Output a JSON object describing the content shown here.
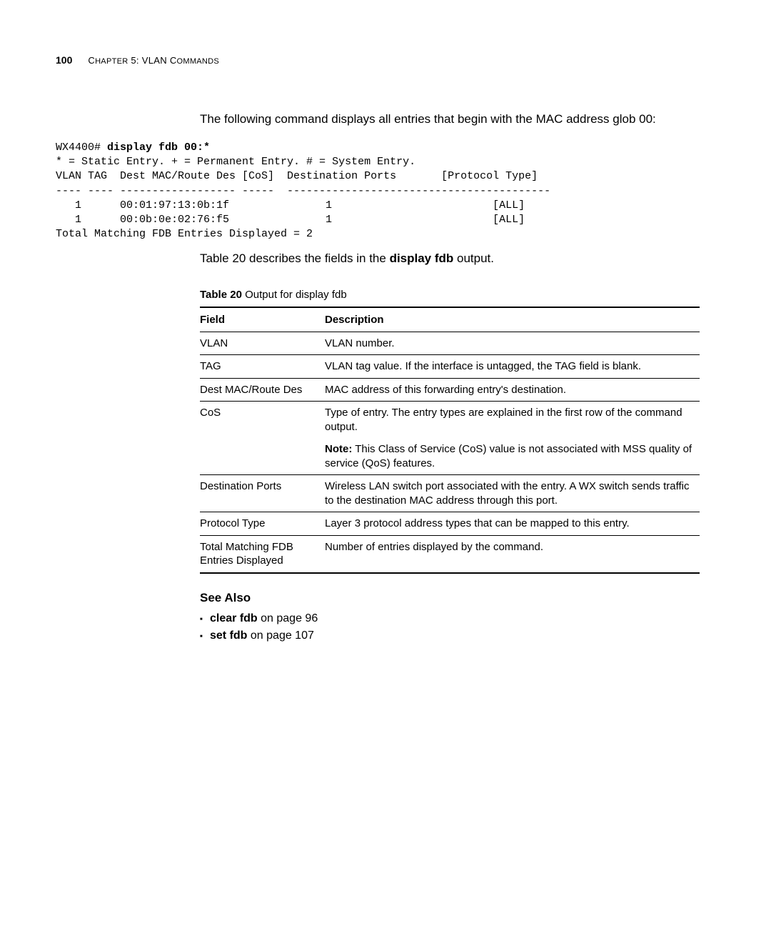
{
  "header": {
    "page_number": "100",
    "chapter_prefix": "C",
    "chapter_small1": "HAPTER",
    "chapter_mid": " 5: VLAN C",
    "chapter_small2": "OMMANDS"
  },
  "intro": "The following command displays all entries that begin with the MAC address glob 00:",
  "code": {
    "prompt": "WX4400# ",
    "cmd": "display fdb 00:*",
    "lines": "* = Static Entry. + = Permanent Entry. # = System Entry.\nVLAN TAG  Dest MAC/Route Des [CoS]  Destination Ports       [Protocol Type]\n---- ---- ------------------ -----  -----------------------------------------\n   1      00:01:97:13:0b:1f               1                         [ALL]\n   1      00:0b:0e:02:76:f5               1                         [ALL]\nTotal Matching FDB Entries Displayed = 2"
  },
  "post_code": {
    "pre": "Table 20 describes the fields in the ",
    "bold": "display fdb",
    "post": " output."
  },
  "table": {
    "caption_bold": "Table 20",
    "caption_rest": "   Output for display fdb",
    "head_field": "Field",
    "head_desc": "Description",
    "rows": [
      {
        "field": "VLAN",
        "desc": "VLAN number."
      },
      {
        "field": "TAG",
        "desc": "VLAN tag value. If the interface is untagged, the TAG field is blank."
      },
      {
        "field": "Dest MAC/Route Des",
        "desc": "MAC address of this forwarding entry's destination."
      },
      {
        "field": "CoS",
        "desc": "Type of entry. The entry types are explained in the first row of the command output."
      },
      {
        "field": "",
        "note_label": "Note:",
        "desc": " This Class of Service (CoS) value is not associated with MSS quality of service (QoS) features."
      },
      {
        "field": "Destination Ports",
        "desc": "Wireless LAN switch port associated with the entry. A WX switch sends traffic to the destination MAC address through this port."
      },
      {
        "field": "Protocol Type",
        "desc": "Layer 3 protocol address types that can be mapped to this entry."
      },
      {
        "field": "Total Matching FDB Entries Displayed",
        "desc": "Number of entries displayed by the command."
      }
    ]
  },
  "see_also": {
    "title": "See Also",
    "items": [
      {
        "bold": "clear fdb",
        "rest": " on page 96"
      },
      {
        "bold": "set fdb",
        "rest": " on page 107"
      }
    ]
  }
}
